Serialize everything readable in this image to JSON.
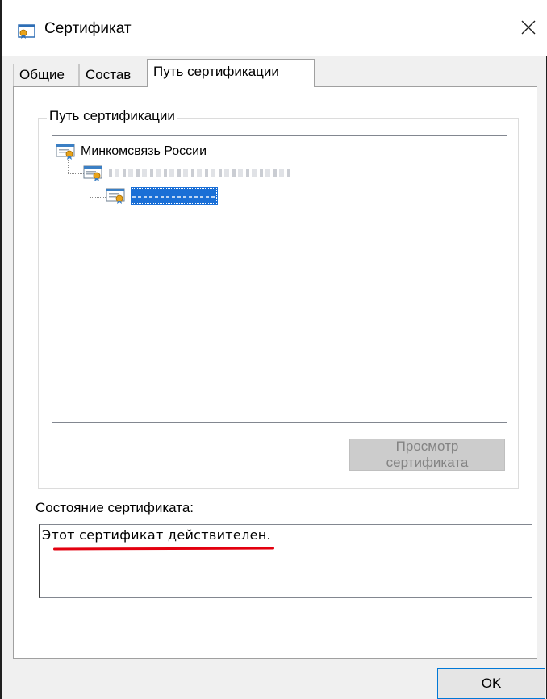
{
  "window": {
    "title": "Сертификат",
    "icon": "certificate-icon",
    "close_icon": "close-icon"
  },
  "tabs": [
    {
      "label": "Общие",
      "active": false
    },
    {
      "label": "Состав",
      "active": false
    },
    {
      "label": "Путь сертификации",
      "active": true
    }
  ],
  "cert_path": {
    "group_title": "Путь сертификации",
    "tree": [
      {
        "label": "Минкомсвязь России",
        "level": 0,
        "redacted": false,
        "selected": false
      },
      {
        "label": "",
        "level": 1,
        "redacted": true,
        "selected": false
      },
      {
        "label": "",
        "level": 2,
        "redacted": true,
        "selected": true
      }
    ],
    "view_button": "Просмотр сертификата",
    "view_button_enabled": false
  },
  "status": {
    "label": "Состояние сертификата:",
    "text": "Этот сертификат действителен.",
    "underline_color": "#e3000f"
  },
  "footer": {
    "ok_label": "OK"
  }
}
